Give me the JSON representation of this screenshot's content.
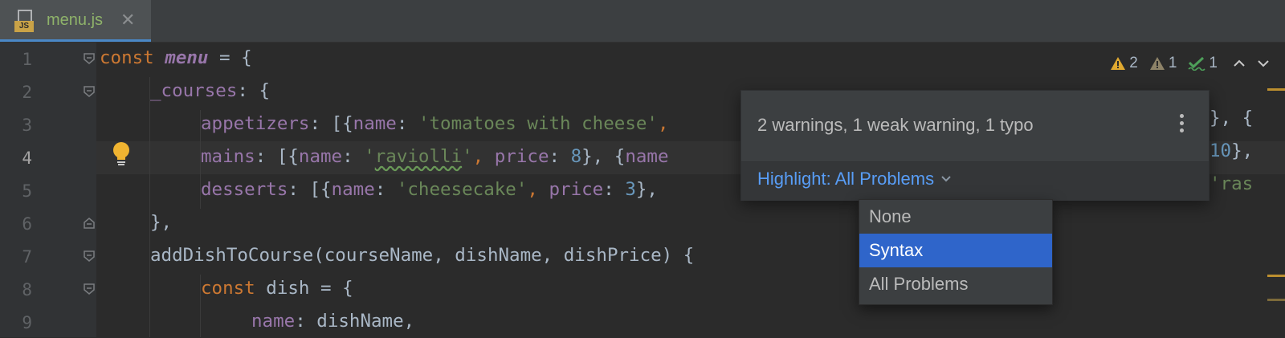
{
  "tab": {
    "label": "menu.js",
    "icon_badge": "JS",
    "close_glyph": "✕"
  },
  "line_numbers": [
    "1",
    "2",
    "3",
    "4",
    "5",
    "6",
    "7",
    "8",
    "9"
  ],
  "inspection": {
    "warnings": "2",
    "weak_warnings": "1",
    "typos": "1",
    "prev_glyph": "⌃",
    "next_glyph": "⌄"
  },
  "popup": {
    "summary": "2 warnings, 1 weak warning, 1 typo",
    "highlight_label": "Highlight: All Problems"
  },
  "highlight_menu": {
    "options": [
      "None",
      "Syntax",
      "All Problems"
    ],
    "selected": "Syntax"
  },
  "code": {
    "l1": {
      "kw": "const",
      "name": "menu",
      "rest": " = {"
    },
    "l2": {
      "prop": "_courses",
      "rest": ": {"
    },
    "l3": {
      "prop": "appetizers",
      "p1": ": [{",
      "k1": "name",
      "p2": ": ",
      "s1": "'tomatoes with cheese'",
      "p3": ",",
      "tail": "}, {"
    },
    "l4": {
      "prop": "mains",
      "p1": ": [{",
      "k1": "name",
      "p2": ": ",
      "s1a": "'",
      "s1b": "raviolli",
      "s1c": "'",
      "p3": ", ",
      "k2": "price",
      "p4": ": ",
      "n1": "8",
      "p5": "}, {",
      "k3": "name",
      "tail_num": "10",
      "tail": "},"
    },
    "l5": {
      "prop": "desserts",
      "p1": ": [{",
      "k1": "name",
      "p2": ": ",
      "s1": "'cheesecake'",
      "p3": ", ",
      "k2": "price",
      "p4": ": ",
      "n1": "3",
      "p5": "}, ",
      "tail": "'ras"
    },
    "l6": {
      "text": "},"
    },
    "l7": {
      "fn": "addDishToCourse",
      "rest": "(courseName, dishName, dishPrice) {"
    },
    "l8": {
      "kw": "const",
      "rest": " dish = {"
    },
    "l9": {
      "prop": "name",
      "rest": ": dishName,"
    }
  },
  "colors": {
    "background": "#2b2b2b",
    "keyword": "#cc7832",
    "property": "#9876aa",
    "string": "#6a8759",
    "number": "#6897bb",
    "link": "#589df6",
    "selection": "#2f65ca",
    "warning": "#e0a930"
  }
}
